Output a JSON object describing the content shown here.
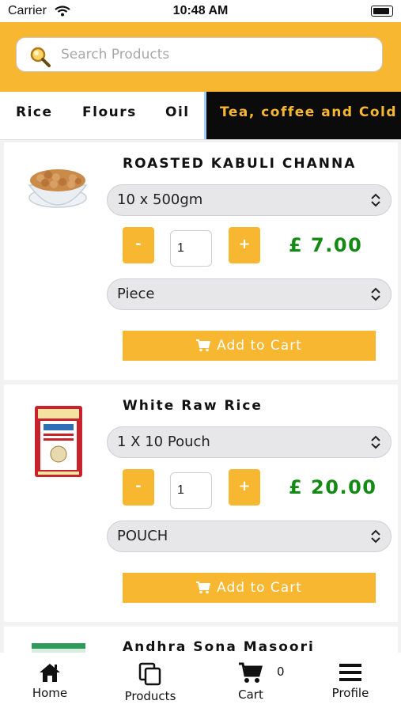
{
  "status_bar": {
    "carrier": "Carrier",
    "time": "10:48 AM"
  },
  "search": {
    "placeholder": "Search Products"
  },
  "categories": [
    {
      "label": "Rice",
      "active": false
    },
    {
      "label": "Flours",
      "active": false
    },
    {
      "label": "Oil",
      "active": false
    },
    {
      "label": "Tea, coffee and Cold",
      "active": true
    }
  ],
  "products": [
    {
      "name": "ROASTED KABULI CHANNA",
      "pack": "10 x 500gm",
      "quantity": "1",
      "price": "£ 7.00",
      "unit": "Piece",
      "add_label": "Add to Cart",
      "minus_label": "-",
      "plus_label": "+"
    },
    {
      "name": "White Raw Rice",
      "pack": "1 X 10 Pouch",
      "quantity": "1",
      "price": "£ 20.00",
      "unit": "POUCH",
      "add_label": "Add to Cart",
      "minus_label": "-",
      "plus_label": "+"
    },
    {
      "name": "Andhra Sona Masoori"
    }
  ],
  "nav": {
    "home": "Home",
    "products": "Products",
    "cart": "Cart",
    "cart_count": "0",
    "profile": "Profile"
  },
  "colors": {
    "accent": "#f7b731",
    "price": "#138a13",
    "active_tab_bg": "#0b0b0b"
  }
}
